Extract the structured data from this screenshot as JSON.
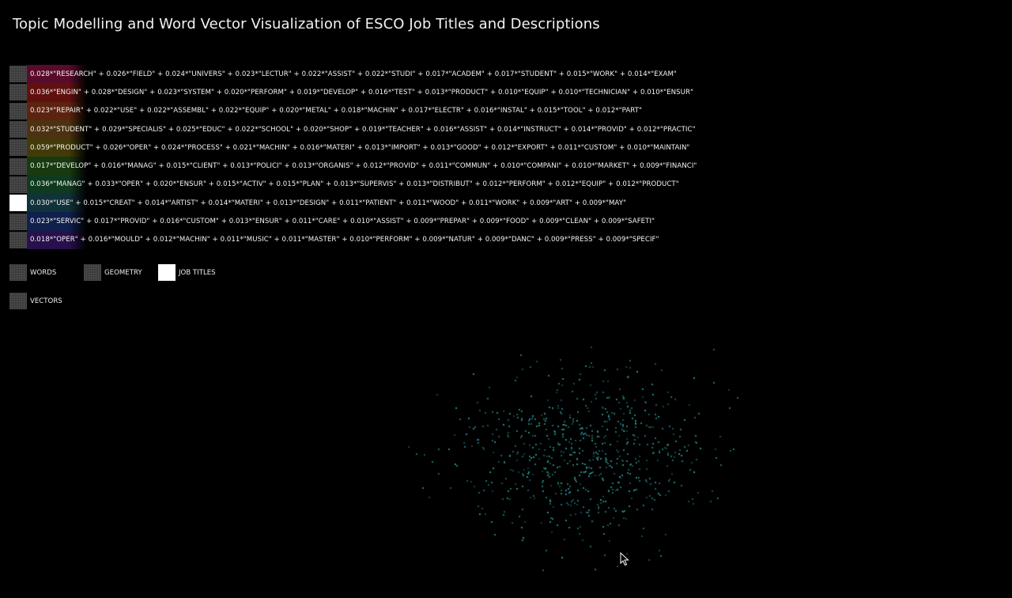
{
  "title": "Topic Modelling and Word Vector Visualization of ESCO Job Titles and Descriptions",
  "topics": [
    {
      "active": false,
      "color": "#a0144e",
      "formula": "0.028*\"RESEARCH\" + 0.026*\"FIELD\" + 0.024*\"UNIVERS\" + 0.023*\"LECTUR\" + 0.022*\"ASSIST\" + 0.022*\"STUDI\" + 0.017*\"ACADEM\" + 0.017*\"STUDENT\" + 0.015*\"WORK\" + 0.014*\"EXAM\""
    },
    {
      "active": false,
      "color": "#b01e1e",
      "formula": "0.036*\"ENGIN\" + 0.028*\"DESIGN\" + 0.023*\"SYSTEM\" + 0.020*\"PERFORM\" + 0.019*\"DEVELOP\" + 0.016*\"TEST\" + 0.013*\"PRODUCT\" + 0.010*\"EQUIP\" + 0.010*\"TECHNICIAN\" + 0.010*\"ENSUR\""
    },
    {
      "active": false,
      "color": "#a8401e",
      "formula": "0.023*\"REPAIR\" + 0.022*\"USE\" + 0.022*\"ASSEMBL\" + 0.022*\"EQUIP\" + 0.020*\"METAL\" + 0.018*\"MACHIN\" + 0.017*\"ELECTR\" + 0.016*\"INSTAL\" + 0.015*\"TOOL\" + 0.012*\"PART\""
    },
    {
      "active": false,
      "color": "#8a5a1c",
      "formula": "0.032*\"STUDENT\" + 0.029*\"SPECIALIS\" + 0.025*\"EDUC\" + 0.022*\"SCHOOL\" + 0.020*\"SHOP\" + 0.019*\"TEACHER\" + 0.016*\"ASSIST\" + 0.014*\"INSTRUCT\" + 0.014*\"PROVID\" + 0.012*\"PRACTIC\""
    },
    {
      "active": false,
      "color": "#7a6a10",
      "formula": "0.059*\"PRODUCT\" + 0.026*\"OPER\" + 0.024*\"PROCESS\" + 0.021*\"MACHIN\" + 0.016*\"MATERI\" + 0.013*\"IMPORT\" + 0.013*\"GOOD\" + 0.012*\"EXPORT\" + 0.011*\"CUSTOM\" + 0.010*\"MAINTAIN\""
    },
    {
      "active": false,
      "color": "#2a6a1e",
      "formula": "0.017*\"DEVELOP\" + 0.016*\"MANAG\" + 0.015*\"CLIENT\" + 0.013*\"POLICI\" + 0.013*\"ORGANIS\" + 0.012*\"PROVID\" + 0.011*\"COMMUN\" + 0.010*\"COMPANI\" + 0.010*\"MARKET\" + 0.009*\"FINANCI\""
    },
    {
      "active": false,
      "color": "#1e6a3a",
      "formula": "0.036*\"MANAG\" + 0.033*\"OPER\" + 0.020*\"ENSUR\" + 0.015*\"ACTIV\" + 0.015*\"PLAN\" + 0.013*\"SUPERVIS\" + 0.013*\"DISTRIBUT\" + 0.012*\"PERFORM\" + 0.012*\"EQUIP\" + 0.012*\"PRODUCT\""
    },
    {
      "active": true,
      "color": "#1e5a6a",
      "formula": "0.030*\"USE\" + 0.015*\"CREAT\" + 0.014*\"ARTIST\" + 0.014*\"MATERI\" + 0.013*\"DESIGN\" + 0.011*\"PATIENT\" + 0.011*\"WOOD\" + 0.011*\"WORK\" + 0.009*\"ART\" + 0.009*\"MAY\""
    },
    {
      "active": false,
      "color": "#1e3a8a",
      "formula": "0.023*\"SERVIC\" + 0.017*\"PROVID\" + 0.016*\"CUSTOM\" + 0.013*\"ENSUR\" + 0.011*\"CARE\" + 0.010*\"ASSIST\" + 0.009*\"PREPAR\" + 0.009*\"FOOD\" + 0.009*\"CLEAN\" + 0.009*\"SAFETI\""
    },
    {
      "active": false,
      "color": "#4a1e8a",
      "formula": "0.018*\"OPER\" + 0.016*\"MOULD\" + 0.012*\"MACHIN\" + 0.011*\"MUSIC\" + 0.011*\"MASTER\" + 0.010*\"PERFORM\" + 0.009*\"NATUR\" + 0.009*\"DANC\" + 0.009*\"PRESS\" + 0.009*\"SPECIF\""
    }
  ],
  "legend": {
    "words": {
      "label": "WORDS",
      "active": false
    },
    "geometry": {
      "label": "GEOMETRY",
      "active": false
    },
    "job_titles": {
      "label": "JOB TITLES",
      "active": true
    },
    "vectors": {
      "label": "VECTORS",
      "active": false
    }
  },
  "point_color": "#2fa6a8"
}
